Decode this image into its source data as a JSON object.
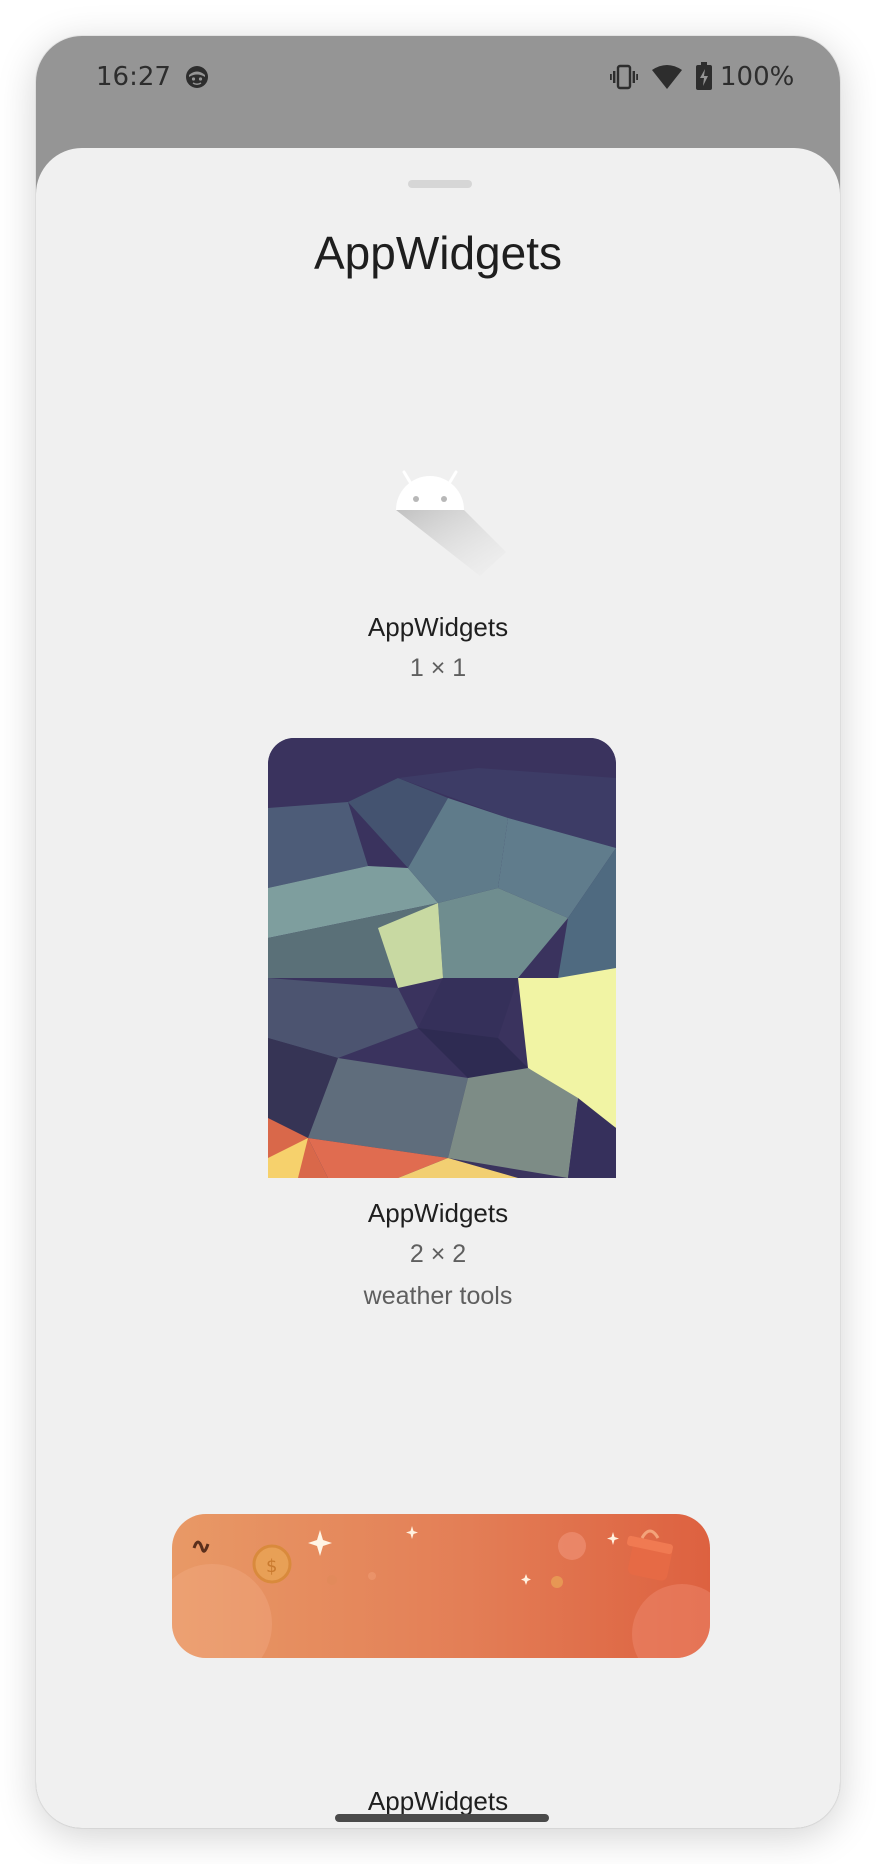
{
  "status_bar": {
    "time": "16:27",
    "battery_text": "100%",
    "icons": [
      "face-notification-icon",
      "vibrate-icon",
      "wifi-icon",
      "battery-charging-icon"
    ]
  },
  "sheet": {
    "title": "AppWidgets"
  },
  "widgets": [
    {
      "label": "AppWidgets",
      "size": "1 × 1",
      "preview": "android-robot-icon"
    },
    {
      "label": "AppWidgets",
      "size": "2 × 2",
      "description": "weather tools",
      "preview": "polygon-wallpaper-image"
    },
    {
      "preview": "orange-rewards-banner-image"
    }
  ],
  "bottom_label": "AppWidgets",
  "colors": {
    "status_bar_bg": "#959595",
    "sheet_bg": "#f0f0f0",
    "title_text": "#1e1e1e",
    "secondary_text": "#5f5f5f",
    "banner_orange": "#e37e56"
  }
}
